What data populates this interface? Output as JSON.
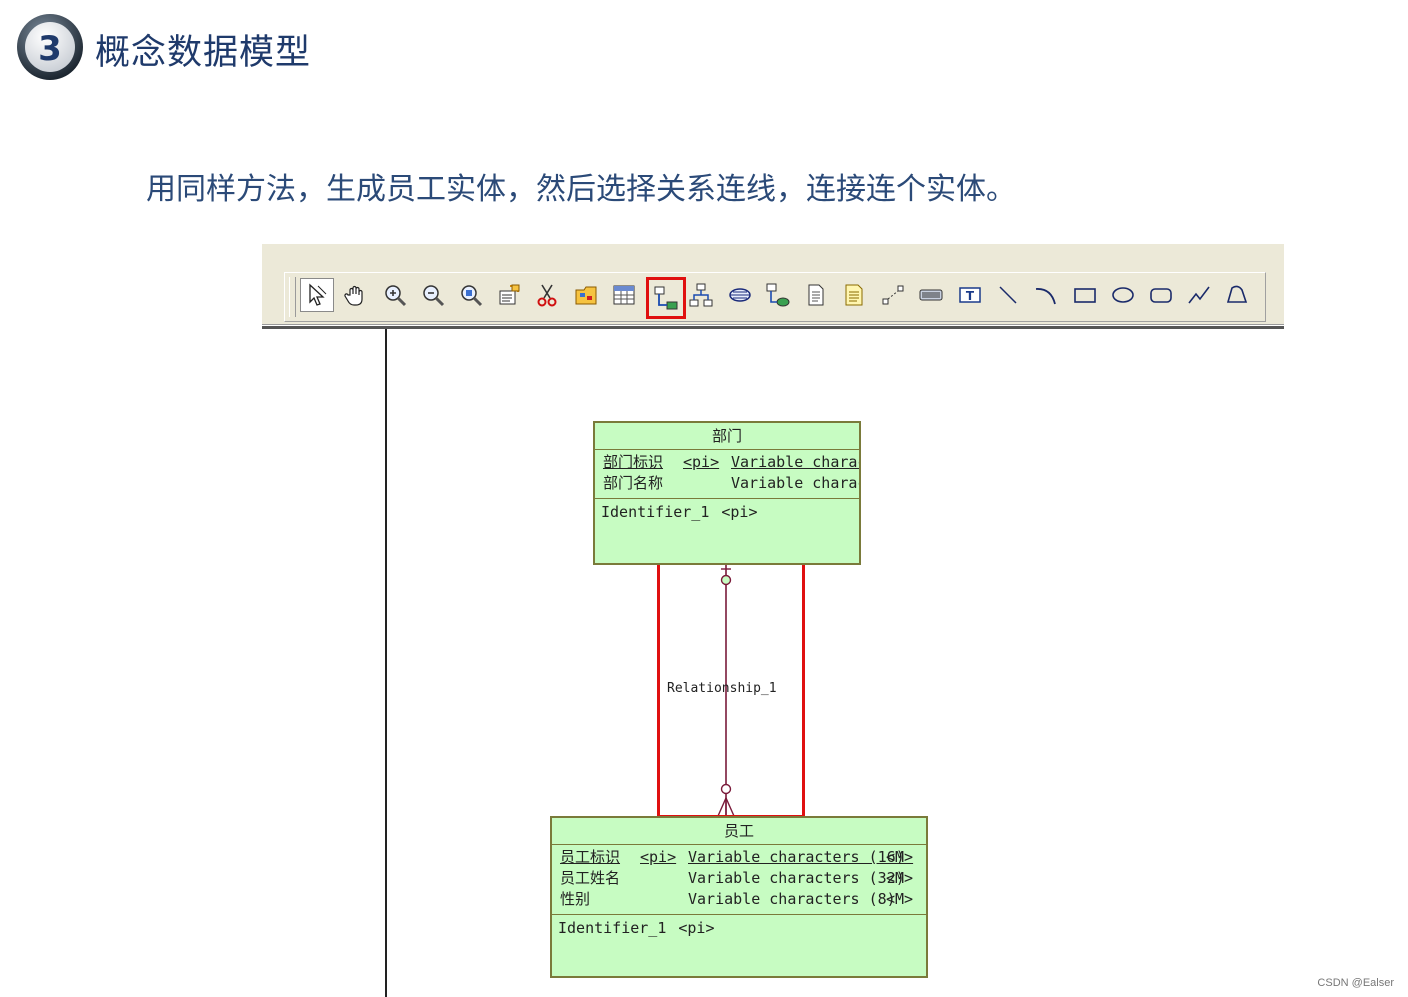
{
  "slide": {
    "number": "3",
    "title": "概念数据模型",
    "instruction": "用同样方法，生成员工实体，然后选择关系连线，连接连个实体。"
  },
  "colors": {
    "entity_fill": "#c7fcc2",
    "entity_border": "#7a7a3a",
    "highlight": "#e01010",
    "relationship_line": "#7a1a3a"
  },
  "toolbar": {
    "tools": [
      {
        "icon": "pointer-icon",
        "selected": true
      },
      {
        "icon": "grabber-hand-icon"
      },
      {
        "icon": "zoom-in-icon"
      },
      {
        "icon": "zoom-out-icon"
      },
      {
        "icon": "open-package-icon"
      },
      {
        "icon": "properties-icon"
      },
      {
        "icon": "delete-scissors-icon"
      },
      {
        "icon": "package-icon"
      },
      {
        "icon": "entity-icon"
      },
      {
        "icon": "relationship-icon",
        "highlighted": true
      },
      {
        "icon": "inheritance-icon"
      },
      {
        "icon": "association-icon"
      },
      {
        "icon": "association-link-icon"
      },
      {
        "icon": "file-icon"
      },
      {
        "icon": "note-icon"
      },
      {
        "icon": "link-icon"
      },
      {
        "icon": "title-icon"
      },
      {
        "icon": "text-icon"
      },
      {
        "icon": "line-icon"
      },
      {
        "icon": "arc-icon"
      },
      {
        "icon": "rectangle-icon"
      },
      {
        "icon": "ellipse-icon"
      },
      {
        "icon": "rounded-rectangle-icon"
      },
      {
        "icon": "polyline-icon"
      },
      {
        "icon": "polygon-icon"
      }
    ]
  },
  "entities": {
    "dept": {
      "name": "部门",
      "attributes": [
        {
          "name": "部门标识",
          "pi": "<pi>",
          "type": "Variable charact",
          "mandatory": ""
        },
        {
          "name": "部门名称",
          "pi": "",
          "type": "Variable charact",
          "mandatory": ""
        }
      ],
      "identifier": {
        "name": "Identifier_1",
        "pi": "<pi>"
      }
    },
    "emp": {
      "name": "员工",
      "attributes": [
        {
          "name": "员工标识",
          "pi": "<pi>",
          "type": "Variable characters (16)",
          "mandatory": "<M>"
        },
        {
          "name": "员工姓名",
          "pi": "",
          "type": "Variable characters (32)",
          "mandatory": "<M>"
        },
        {
          "name": "性别",
          "pi": "",
          "type": "Variable characters (8)",
          "mandatory": "<M>"
        }
      ],
      "identifier": {
        "name": "Identifier_1",
        "pi": "<pi>"
      }
    }
  },
  "relationship": {
    "name": "Relationship_1",
    "cardinality_top": "0,1",
    "cardinality_bottom": "0,n"
  },
  "watermark": "CSDN @Ealser"
}
